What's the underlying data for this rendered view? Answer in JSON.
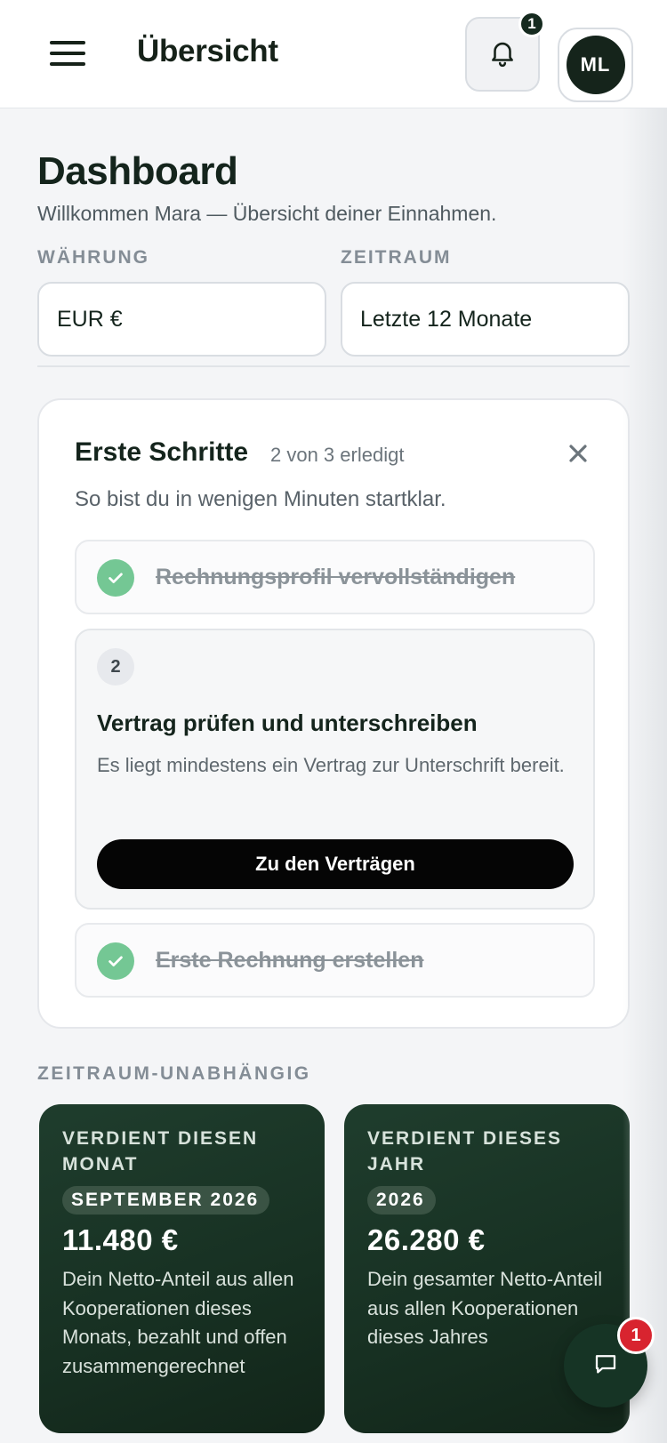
{
  "header": {
    "title": "Übersicht",
    "notification_count": "1",
    "avatar_initials": "ML"
  },
  "page": {
    "title": "Dashboard",
    "subtitle": "Willkommen Mara — Übersicht deiner Einnahmen."
  },
  "filters": {
    "currency_label": "WÄHRUNG",
    "currency_value": "EUR €",
    "period_label": "ZEITRAUM",
    "period_value": "Letzte 12 Monate"
  },
  "onboarding": {
    "title": "Erste Schritte",
    "progress": "2 von 3 erledigt",
    "description": "So bist du in wenigen Minuten startklar.",
    "steps": [
      {
        "label": "Rechnungsprofil vervollständigen",
        "done": true
      },
      {
        "number": "2",
        "title": "Vertrag prüfen und unterschreiben",
        "description": "Es liegt mindestens ein Vertrag zur Unterschrift bereit.",
        "button_label": "Zu den Verträgen",
        "done": false
      },
      {
        "label": "Erste Rechnung erstellen",
        "done": true
      }
    ]
  },
  "stats": {
    "section_label": "ZEITRAUM-UNABHÄNGIG",
    "cards": [
      {
        "label_line1": "VERDIENT DIESEN",
        "label_line2": "MONAT",
        "period": "SEPTEMBER 2026",
        "value": "11.480 €",
        "description": "Dein Netto-Anteil aus allen Kooperationen dieses Monats, bezahlt und offen zusammengerechnet"
      },
      {
        "label_line1": "VERDIENT DIESES",
        "label_line2": "JAHR",
        "period": "2026",
        "value": "26.280 €",
        "description": "Dein gesamter Netto-Anteil aus allen Kooperationen dieses Jahres"
      }
    ]
  },
  "chat": {
    "unread_count": "1"
  },
  "colors": {
    "brand_dark": "#152a1f",
    "success": "#74c794",
    "alert": "#d8242f"
  },
  "icons": [
    "menu-icon",
    "bell-icon",
    "close-icon",
    "check-icon",
    "chat-icon"
  ]
}
